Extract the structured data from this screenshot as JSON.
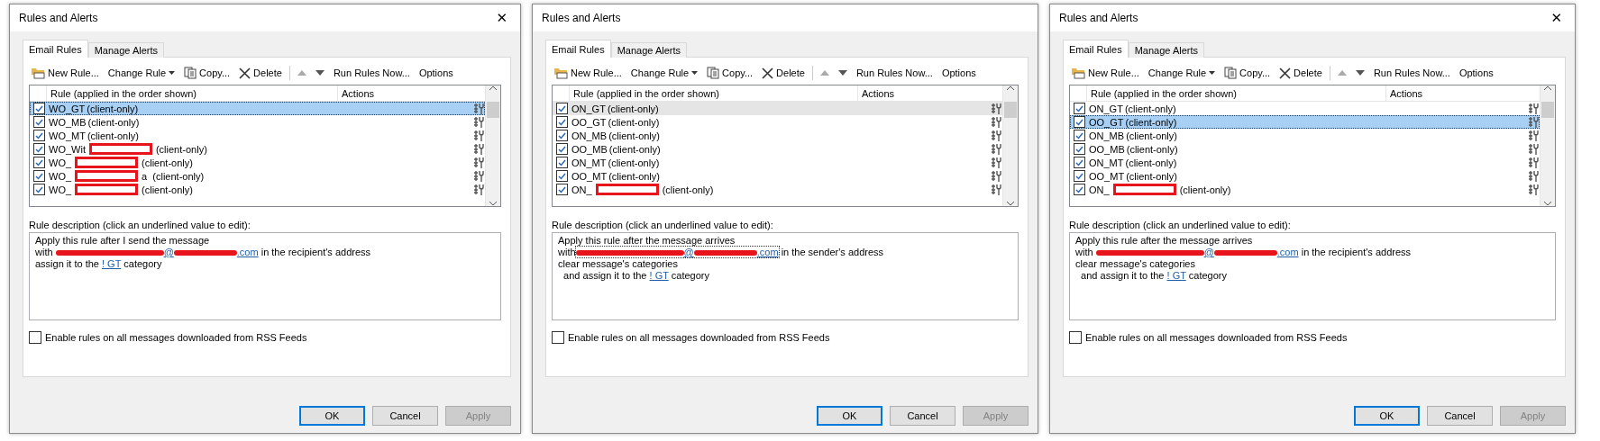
{
  "dialogs": [
    {
      "title": "Rules and Alerts",
      "close": "✕",
      "list_focused": true,
      "tabs": [
        {
          "label": "Email Rules",
          "selected": true
        },
        {
          "label": "Manage Alerts",
          "selected": false
        }
      ],
      "toolbar": [
        {
          "kind": "new",
          "label": "New Rule..."
        },
        {
          "kind": "change",
          "label": "Change Rule"
        },
        {
          "kind": "copy",
          "label": "Copy..."
        },
        {
          "kind": "delete",
          "label": "Delete"
        },
        {
          "kind": "separator"
        },
        {
          "kind": "up"
        },
        {
          "kind": "down"
        },
        {
          "kind": "run",
          "label": "Run Rules Now..."
        },
        {
          "kind": "options",
          "label": "Options"
        }
      ],
      "columns": [
        "Rule (applied in the order shown)",
        "Actions"
      ],
      "rules": [
        {
          "name": "WO_GT",
          "tail": "(client-only)",
          "checked": true,
          "selected": true,
          "redacted": false
        },
        {
          "name": "WO_MB",
          "tail": "(client-only)",
          "checked": true,
          "selected": false,
          "redacted": false
        },
        {
          "name": "WO_MT",
          "tail": "(client-only)",
          "checked": true,
          "selected": false,
          "redacted": false
        },
        {
          "name": "WO_Wit",
          "tail": "(client-only)",
          "checked": true,
          "selected": false,
          "redacted": true
        },
        {
          "name": "WO_",
          "tail": "(client-only)",
          "checked": true,
          "selected": false,
          "redacted": true
        },
        {
          "name": "WO_",
          "tail": "a  (client-only)",
          "checked": true,
          "selected": false,
          "redacted": true
        },
        {
          "name": "WO_",
          "tail": "(client-only)",
          "checked": true,
          "selected": false,
          "redacted": true
        }
      ],
      "description_label": "Rule description (click an underlined value to edit):",
      "description": [
        {
          "kind": "text",
          "text": "Apply this rule after I send the message"
        },
        {
          "kind": "email",
          "before": "with ",
          "link": [
            "@",
            ".com"
          ],
          "after": " in the recipient's address",
          "focused": false
        },
        {
          "kind": "category",
          "before": "assign it to the ",
          "link": "! GT",
          "after": " category"
        }
      ],
      "rss": {
        "label": "Enable rules on all messages downloaded from RSS Feeds",
        "checked": false
      },
      "buttons": [
        {
          "label": "OK",
          "default": true,
          "disabled": false
        },
        {
          "label": "Cancel",
          "default": false,
          "disabled": false
        },
        {
          "label": "Apply",
          "default": false,
          "disabled": true
        }
      ]
    },
    {
      "title": "Rules and Alerts",
      "list_focused": false,
      "tabs": [
        {
          "label": "Email Rules",
          "selected": true
        },
        {
          "label": "Manage Alerts",
          "selected": false
        }
      ],
      "toolbar": [
        {
          "kind": "new",
          "label": "New Rule..."
        },
        {
          "kind": "change",
          "label": "Change Rule"
        },
        {
          "kind": "copy",
          "label": "Copy..."
        },
        {
          "kind": "delete",
          "label": "Delete"
        },
        {
          "kind": "separator"
        },
        {
          "kind": "up"
        },
        {
          "kind": "down"
        },
        {
          "kind": "run",
          "label": "Run Rules Now..."
        },
        {
          "kind": "options",
          "label": "Options"
        }
      ],
      "columns": [
        "Rule (applied in the order shown)",
        "Actions"
      ],
      "rules": [
        {
          "name": "ON_GT",
          "tail": "(client-only)",
          "checked": true,
          "selected": true,
          "redacted": false
        },
        {
          "name": "OO_GT",
          "tail": "(client-only)",
          "checked": true,
          "selected": false,
          "redacted": false
        },
        {
          "name": "ON_MB",
          "tail": "(client-only)",
          "checked": true,
          "selected": false,
          "redacted": false
        },
        {
          "name": "OO_MB",
          "tail": "(client-only)",
          "checked": true,
          "selected": false,
          "redacted": false
        },
        {
          "name": "ON_MT",
          "tail": "(client-only)",
          "checked": true,
          "selected": false,
          "redacted": false
        },
        {
          "name": "OO_MT",
          "tail": "(client-only)",
          "checked": true,
          "selected": false,
          "redacted": false
        },
        {
          "name": "ON_",
          "tail": "(client-only)",
          "checked": true,
          "selected": false,
          "redacted": true
        }
      ],
      "description_label": "Rule description (click an underlined value to edit):",
      "description": [
        {
          "kind": "text",
          "text": "Apply this rule after the message arrives"
        },
        {
          "kind": "email",
          "before": "with",
          "link": [
            "@",
            ".com"
          ],
          "after": " in the sender's address",
          "focused": true
        },
        {
          "kind": "text",
          "text": "clear message's categories"
        },
        {
          "kind": "category",
          "before": "  and assign it to the ",
          "link": "! GT",
          "after": " category"
        }
      ],
      "rss": {
        "label": "Enable rules on all messages downloaded from RSS Feeds",
        "checked": false
      },
      "buttons": [
        {
          "label": "OK",
          "default": true,
          "disabled": false
        },
        {
          "label": "Cancel",
          "default": false,
          "disabled": false
        },
        {
          "label": "Apply",
          "default": false,
          "disabled": true
        }
      ]
    },
    {
      "title": "Rules and Alerts",
      "close": "✕",
      "list_focused": true,
      "tabs": [
        {
          "label": "Email Rules",
          "selected": true
        },
        {
          "label": "Manage Alerts",
          "selected": false
        }
      ],
      "toolbar": [
        {
          "kind": "new",
          "label": "New Rule..."
        },
        {
          "kind": "change",
          "label": "Change Rule"
        },
        {
          "kind": "copy",
          "label": "Copy..."
        },
        {
          "kind": "delete",
          "label": "Delete"
        },
        {
          "kind": "separator"
        },
        {
          "kind": "up"
        },
        {
          "kind": "down"
        },
        {
          "kind": "run",
          "label": "Run Rules Now..."
        },
        {
          "kind": "options",
          "label": "Options"
        }
      ],
      "columns": [
        "Rule (applied in the order shown)",
        "Actions"
      ],
      "rules": [
        {
          "name": "ON_GT",
          "tail": "(client-only)",
          "checked": true,
          "selected": false,
          "redacted": false
        },
        {
          "name": "OO_GT",
          "tail": "(client-only)",
          "checked": true,
          "selected": true,
          "redacted": false
        },
        {
          "name": "ON_MB",
          "tail": "(client-only)",
          "checked": true,
          "selected": false,
          "redacted": false
        },
        {
          "name": "OO_MB",
          "tail": "(client-only)",
          "checked": true,
          "selected": false,
          "redacted": false
        },
        {
          "name": "ON_MT",
          "tail": "(client-only)",
          "checked": true,
          "selected": false,
          "redacted": false
        },
        {
          "name": "OO_MT",
          "tail": "(client-only)",
          "checked": true,
          "selected": false,
          "redacted": false
        },
        {
          "name": "ON_",
          "tail": "(client-only)",
          "checked": true,
          "selected": false,
          "redacted": true
        }
      ],
      "description_label": "Rule description (click an underlined value to edit):",
      "description": [
        {
          "kind": "text",
          "text": "Apply this rule after the message arrives"
        },
        {
          "kind": "email",
          "before": "with ",
          "link": [
            "@",
            ".com"
          ],
          "after": " in the recipient's address",
          "focused": false
        },
        {
          "kind": "text",
          "text": "clear message's categories"
        },
        {
          "kind": "category",
          "before": "  and assign it to the ",
          "link": "! GT",
          "after": " category"
        }
      ],
      "rss": {
        "label": "Enable rules on all messages downloaded from RSS Feeds",
        "checked": false
      },
      "buttons": [
        {
          "label": "OK",
          "default": true,
          "disabled": false
        },
        {
          "label": "Cancel",
          "default": false,
          "disabled": false
        },
        {
          "label": "Apply",
          "default": false,
          "disabled": true
        }
      ]
    }
  ]
}
